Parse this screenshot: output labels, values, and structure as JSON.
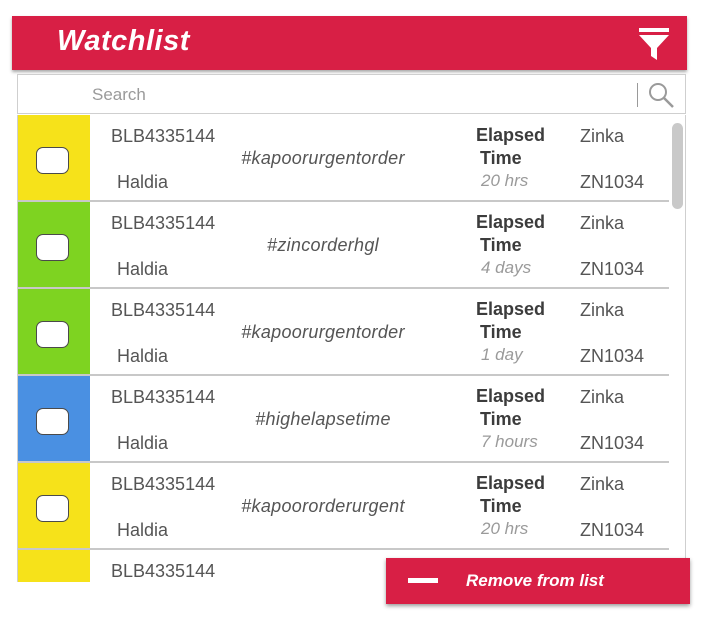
{
  "header": {
    "title": "Watchlist",
    "filter_icon": "filter-icon"
  },
  "search": {
    "placeholder": "Search",
    "icon": "search-icon"
  },
  "colors": {
    "accent": "#d81f45",
    "yellow": "#f6e21a",
    "green": "#7ed321",
    "blue": "#4a90e2"
  },
  "rows": [
    {
      "status_color": "#f6e21a",
      "order_id": "BLB4335144",
      "location": "Haldia",
      "tag": "#kapoorurgentorder",
      "elapsed_label_1": "Elapsed",
      "elapsed_label_2": "Time",
      "elapsed_value": "20 hrs",
      "customer": "Zinka",
      "code": "ZN1034"
    },
    {
      "status_color": "#7ed321",
      "order_id": "BLB4335144",
      "location": "Haldia",
      "tag": "#zincorderhgl",
      "elapsed_label_1": "Elapsed",
      "elapsed_label_2": "Time",
      "elapsed_value": "4 days",
      "customer": "Zinka",
      "code": "ZN1034"
    },
    {
      "status_color": "#7ed321",
      "order_id": "BLB4335144",
      "location": "Haldia",
      "tag": "#kapoorurgentorder",
      "elapsed_label_1": "Elapsed",
      "elapsed_label_2": "Time",
      "elapsed_value": "1 day",
      "customer": "Zinka",
      "code": "ZN1034"
    },
    {
      "status_color": "#4a90e2",
      "order_id": "BLB4335144",
      "location": "Haldia",
      "tag": "#highelapsetime",
      "elapsed_label_1": "Elapsed",
      "elapsed_label_2": "Time",
      "elapsed_value": "7 hours",
      "customer": "Zinka",
      "code": "ZN1034"
    },
    {
      "status_color": "#f6e21a",
      "order_id": "BLB4335144",
      "location": "Haldia",
      "tag": "#kapoororderurgent",
      "elapsed_label_1": "Elapsed",
      "elapsed_label_2": "Time",
      "elapsed_value": "20 hrs",
      "customer": "Zinka",
      "code": "ZN1034"
    },
    {
      "status_color": "#f6e21a",
      "order_id": "BLB4335144"
    }
  ],
  "actions": {
    "remove_label": "Remove from list",
    "remove_icon": "minus-icon"
  }
}
